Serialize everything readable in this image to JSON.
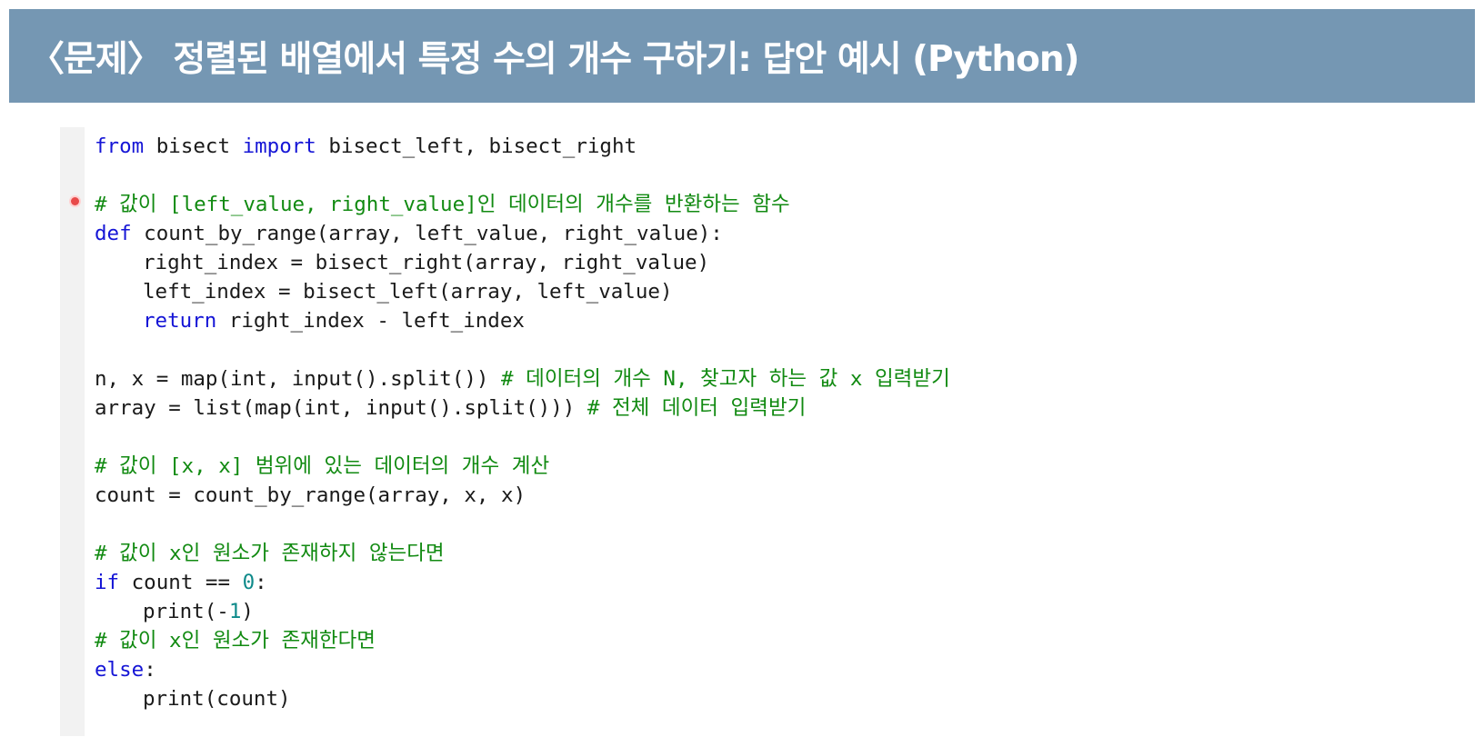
{
  "title": "〈문제〉 정렬된 배열에서 특정 수의 개수 구하기: 답안 예시 (Python)",
  "code": {
    "l1": {
      "kw1": "from",
      "t1": " bisect ",
      "kw2": "import",
      "t2": " bisect_left, bisect_right"
    },
    "l3": {
      "c": "# 값이 [left_value, right_value]인 데이터의 개수를 반환하는 함수"
    },
    "l4": {
      "kw": "def",
      "t": " count_by_range(array, left_value, right_value):"
    },
    "l5": {
      "t": "right_index = bisect_right(array, right_value)"
    },
    "l6": {
      "t": "left_index = bisect_left(array, left_value)"
    },
    "l7": {
      "kw": "return",
      "t": " right_index - left_index"
    },
    "l9": {
      "t": "n, x = map(int, input().split()) ",
      "c": "# 데이터의 개수 N, 찾고자 하는 값 x 입력받기"
    },
    "l10": {
      "t": "array = list(map(int, input().split())) ",
      "c": "# 전체 데이터 입력받기"
    },
    "l12": {
      "c": "# 값이 [x, x] 범위에 있는 데이터의 개수 계산"
    },
    "l13": {
      "t": "count = count_by_range(array, x, x)"
    },
    "l15": {
      "c": "# 값이 x인 원소가 존재하지 않는다면"
    },
    "l16": {
      "kw": "if",
      "t1": " count == ",
      "n": "0",
      "t2": ":"
    },
    "l17": {
      "t1": "print(-",
      "n": "1",
      "t2": ")"
    },
    "l18": {
      "c": "# 값이 x인 원소가 존재한다면"
    },
    "l19": {
      "kw": "else",
      "t": ":"
    },
    "l20": {
      "t": "print(count)"
    }
  }
}
